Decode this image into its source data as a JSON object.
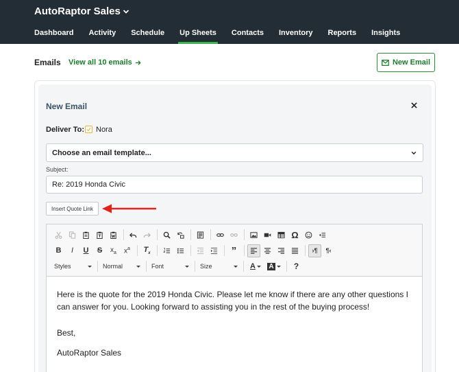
{
  "header": {
    "brand": "AutoRaptor Sales",
    "nav": [
      "Dashboard",
      "Activity",
      "Schedule",
      "Up Sheets",
      "Contacts",
      "Inventory",
      "Reports",
      "Insights"
    ],
    "active_nav": "Up Sheets"
  },
  "emails": {
    "label": "Emails",
    "view_all": "View all 10 emails",
    "new_email_button": "New Email"
  },
  "composer": {
    "title": "New Email",
    "deliver_to_label": "Deliver To:",
    "recipient": "Nora",
    "recipient_checked": true,
    "template_placeholder": "Choose an email template...",
    "subject_label": "Subject:",
    "subject_value": "Re: 2019 Honda Civic",
    "insert_quote_button": "Insert Quote Link",
    "annotation_arrow_color": "#e0241b"
  },
  "editor": {
    "styles_combo": "Styles",
    "format_combo": "Normal",
    "font_combo": "Font",
    "size_combo": "Size",
    "body_paragraph": "Here is the quote for the 2019 Honda Civic. Please let me know if there are any other questions I can answer for you. Looking forward to assisting you in the rest of the buying process!",
    "sign_off": "Best,",
    "signature": "AutoRaptor Sales"
  },
  "colors": {
    "header_bg": "#222d35",
    "accent_green": "#1f7a2e",
    "active_tab_underline": "#3fb34f",
    "panel_title": "#3a5266"
  }
}
